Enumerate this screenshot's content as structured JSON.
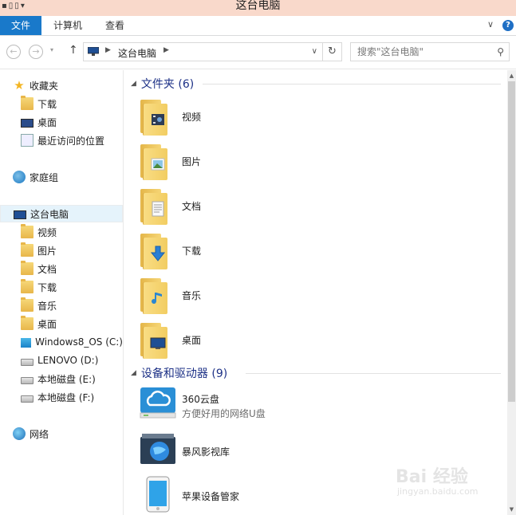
{
  "window": {
    "title": "这台电脑"
  },
  "ribbon": {
    "tabs": [
      "文件",
      "计算机",
      "查看"
    ]
  },
  "address_bar": {
    "crumb": "这台电脑",
    "search_placeholder": "搜索\"这台电脑\""
  },
  "sidebar": {
    "favorites": {
      "label": "收藏夹",
      "items": [
        "下载",
        "桌面",
        "最近访问的位置"
      ]
    },
    "homegroup": "家庭组",
    "this_pc": {
      "label": "这台电脑",
      "items": [
        {
          "label": "视频",
          "icon": "video-folder-icon"
        },
        {
          "label": "图片",
          "icon": "pictures-folder-icon"
        },
        {
          "label": "文档",
          "icon": "documents-folder-icon"
        },
        {
          "label": "下载",
          "icon": "downloads-folder-icon"
        },
        {
          "label": "音乐",
          "icon": "music-folder-icon"
        },
        {
          "label": "桌面",
          "icon": "desktop-folder-icon"
        },
        {
          "label": "Windows8_OS (C:)",
          "icon": "windows-drive-icon"
        },
        {
          "label": "LENOVO (D:)",
          "icon": "drive-icon"
        },
        {
          "label": "本地磁盘 (E:)",
          "icon": "drive-icon"
        },
        {
          "label": "本地磁盘 (F:)",
          "icon": "drive-icon"
        }
      ]
    },
    "network": "网络"
  },
  "content": {
    "folders_group": {
      "title": "文件夹 (6)",
      "items": [
        "视频",
        "图片",
        "文档",
        "下载",
        "音乐",
        "桌面"
      ]
    },
    "devices_group": {
      "title": "设备和驱动器 (9)",
      "items": [
        {
          "name": "360云盘",
          "subtitle": "方便好用的网络U盘"
        },
        {
          "name": "暴风影视库",
          "subtitle": ""
        },
        {
          "name": "苹果设备管家",
          "subtitle": ""
        }
      ]
    }
  },
  "watermark": {
    "brand": "Bai 经验",
    "url": "jingyan.baidu.com"
  },
  "colors": {
    "accent": "#1979ca",
    "selection": "#e5f3fb",
    "group_header": "#1e3287",
    "titlebar": "#f9d9cb"
  }
}
